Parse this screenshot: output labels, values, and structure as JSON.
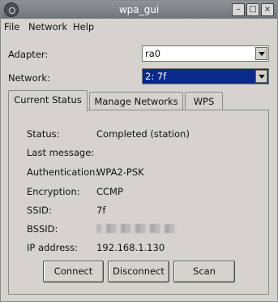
{
  "window": {
    "title": "wpa_gui"
  },
  "menu": {
    "file": "File",
    "network": "Network",
    "help": "Help"
  },
  "adapter": {
    "label": "Adapter:",
    "value": "ra0"
  },
  "network": {
    "label": "Network:",
    "value": "2: 7f"
  },
  "tabs": [
    {
      "label": "Current Status"
    },
    {
      "label": "Manage Networks"
    },
    {
      "label": "WPS"
    }
  ],
  "status": {
    "status_label": "Status:",
    "status_value": "Completed (station)",
    "last_message_label": "Last message:",
    "last_message_value": "",
    "auth_label": "Authentication:",
    "auth_value": "WPA2-PSK",
    "encryption_label": "Encryption:",
    "encryption_value": "CCMP",
    "ssid_label": "SSID:",
    "ssid_value": "7f",
    "bssid_label": "BSSID:",
    "ip_label": "IP address:",
    "ip_value": "192.168.1.130"
  },
  "buttons": {
    "connect": "Connect",
    "disconnect": "Disconnect",
    "scan": "Scan"
  },
  "icons": {
    "app": "wpa-gui-app-icon",
    "minimize": "minimize-icon",
    "maximize": "maximize-icon",
    "close": "close-icon",
    "dropdown": "chevron-down-icon"
  },
  "colors": {
    "titlebar": "#7f838a",
    "selection": "#0a2a8a",
    "window_bg": "#d6d3ce"
  }
}
